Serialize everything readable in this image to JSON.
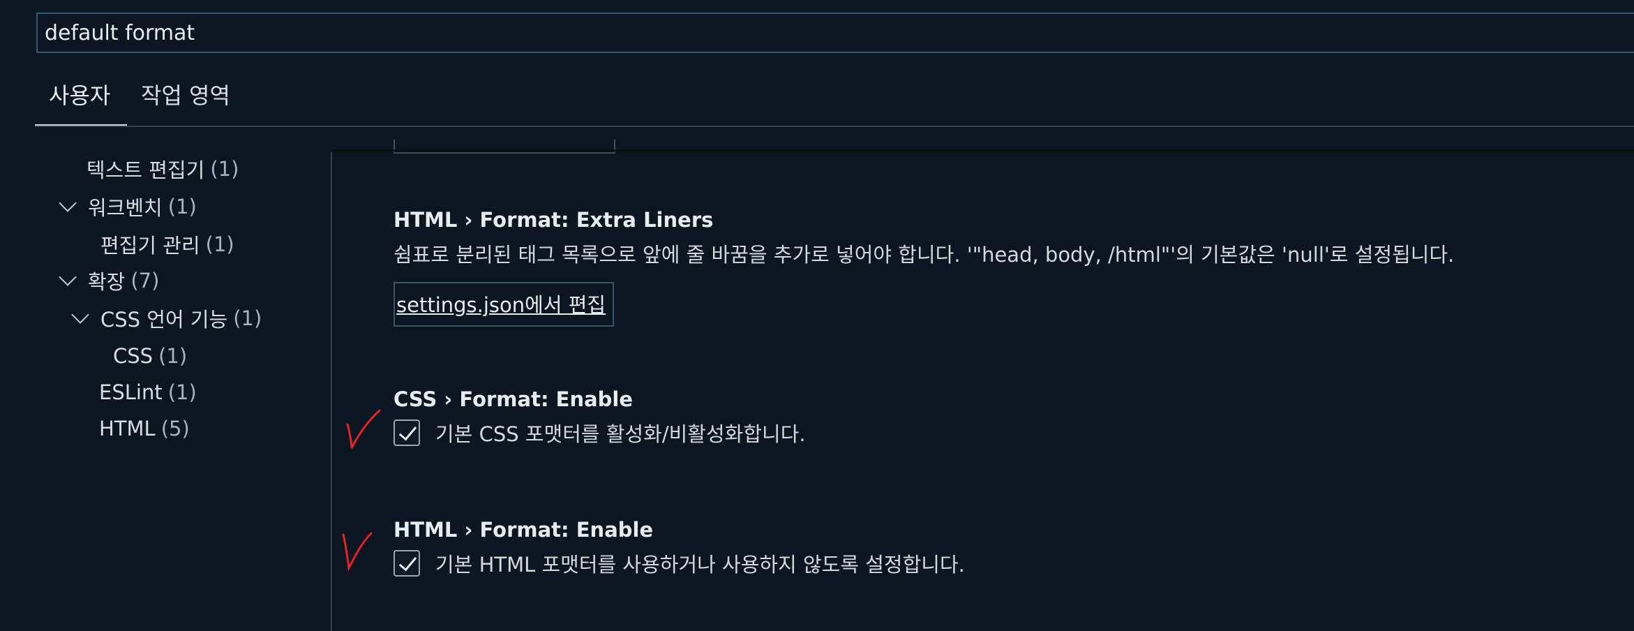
{
  "search": {
    "value": "default format"
  },
  "tabs": [
    {
      "label": "사용자"
    },
    {
      "label": "작업 영역"
    }
  ],
  "tree": {
    "items": [
      {
        "label": "텍스트 편집기",
        "count": "(1)"
      },
      {
        "label": "워크벤치",
        "count": "(1)"
      },
      {
        "label": "편집기 관리",
        "count": "(1)"
      },
      {
        "label": "확장",
        "count": "(7)"
      },
      {
        "label": "CSS 언어 기능",
        "count": "(1)"
      },
      {
        "label": "CSS",
        "count": "(1)"
      },
      {
        "label": "ESLint",
        "count": "(1)"
      },
      {
        "label": "HTML",
        "count": "(5)"
      }
    ]
  },
  "settings": {
    "extra_liners": {
      "title": "HTML › Format: Extra Liners",
      "description": "쉼표로 분리된 태그 목록으로 앞에 줄 바꿈을 추가로 넣어야 합니다. '\"head, body, /html\"'의 기본값은 'null'로 설정됩니다.",
      "edit_link": "settings.json에서 편집"
    },
    "css_format_enable": {
      "title": "CSS › Format: Enable",
      "label": "기본 CSS 포맷터를 활성화/비활성화합니다.",
      "checked": true
    },
    "html_format_enable": {
      "title": "HTML › Format: Enable",
      "label": "기본 HTML 포맷터를 사용하거나 사용하지 않도록 설정합니다.",
      "checked": true
    }
  },
  "colors": {
    "background": "#0b1620",
    "border": "#2f5b76",
    "annotation": "#e0242a"
  }
}
